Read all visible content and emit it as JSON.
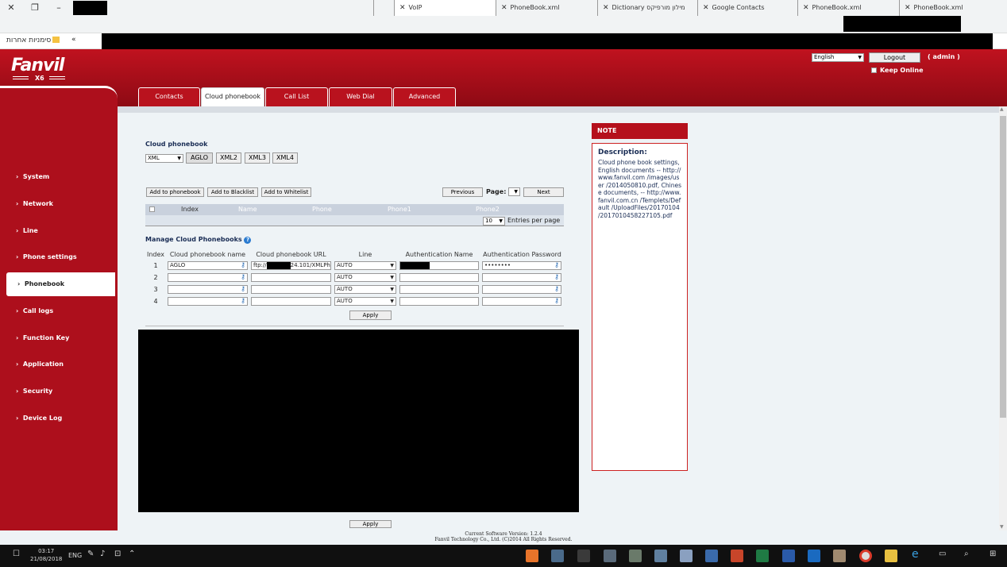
{
  "browser": {
    "tabs": [
      {
        "title": "VoIP",
        "active": true
      },
      {
        "title": "PhoneBook.xml",
        "active": false
      },
      {
        "title": "Dictionary מילון מורפיקס",
        "active": false
      },
      {
        "title": "Google Contacts",
        "active": false
      },
      {
        "title": "PhoneBook.xml",
        "active": false
      },
      {
        "title": "PhoneBook.xml",
        "active": false
      }
    ],
    "address_prefix": "⊶",
    "bookmarks_label": "סימניות אחרות",
    "bookmarks_chevron": "«"
  },
  "header": {
    "logo": "Fanvil",
    "model": "X6",
    "language": "English",
    "logout_label": "Logout",
    "user": "( admin )",
    "keep_online": "Keep Online"
  },
  "top_tabs": [
    "Contacts",
    "Cloud phonebook",
    "Call List",
    "Web Dial",
    "Advanced"
  ],
  "active_tab": "Cloud phonebook",
  "sidebar": {
    "items": [
      {
        "label": "System"
      },
      {
        "label": "Network"
      },
      {
        "label": "Line"
      },
      {
        "label": "Phone settings"
      },
      {
        "label": "Phonebook"
      },
      {
        "label": "Call logs"
      },
      {
        "label": "Function Key"
      },
      {
        "label": "Application"
      },
      {
        "label": "Security"
      },
      {
        "label": "Device Log"
      }
    ],
    "active": "Phonebook"
  },
  "cloud": {
    "title": "Cloud phonebook",
    "format_select": "XML",
    "book_buttons": [
      "AGLO",
      "XML2",
      "XML3",
      "XML4"
    ],
    "actions": {
      "add_phonebook": "Add to phonebook",
      "add_blacklist": "Add to Blacklist",
      "add_whitelist": "Add to Whitelist",
      "previous": "Previous",
      "page_label": "Page:",
      "next": "Next"
    },
    "list_columns": [
      "Index",
      "Name",
      "Phone",
      "Phone1",
      "Phone2"
    ],
    "entries_per_page": "10",
    "entries_label": "Entries per page"
  },
  "manage": {
    "title": "Manage Cloud Phonebooks",
    "columns": [
      "Index",
      "Cloud phonebook name",
      "Cloud phonebook URL",
      "Line",
      "Authentication Name",
      "Authentication Password"
    ],
    "rows": [
      {
        "index": "1",
        "name": "AGLO",
        "url_prefix": "ftp://",
        "url_suffix": "24.101/XMLPh",
        "line": "AUTO",
        "password": "••••••••"
      },
      {
        "index": "2",
        "name": "",
        "url_prefix": "",
        "url_suffix": "",
        "line": "AUTO",
        "password": ""
      },
      {
        "index": "3",
        "name": "",
        "url_prefix": "",
        "url_suffix": "",
        "line": "AUTO",
        "password": ""
      },
      {
        "index": "4",
        "name": "",
        "url_prefix": "",
        "url_suffix": "",
        "line": "AUTO",
        "password": ""
      }
    ],
    "apply_label": "Apply",
    "apply_label_2": "Apply"
  },
  "note": {
    "header": "NOTE",
    "title": "Description:",
    "text": "Cloud phone book settings, English documents -- http://www.fanvil.com /images/user /2014050810.pdf, Chinese documents, -- http://www.fanvil.com.cn /Templets/Default /UploadFiles/20170104 /20170104582271​05.pdf"
  },
  "footer": {
    "version": "Current Software Version: 1.2.4",
    "copyright": "Fanvil Technology Co., Ltd. (C)2014 All Rights Reserved."
  },
  "taskbar": {
    "time": "03:17",
    "date": "21/08/2018",
    "lang": "ENG"
  },
  "colors": {
    "brand_red": "#b5101c",
    "title_blue": "#1a2d55"
  }
}
